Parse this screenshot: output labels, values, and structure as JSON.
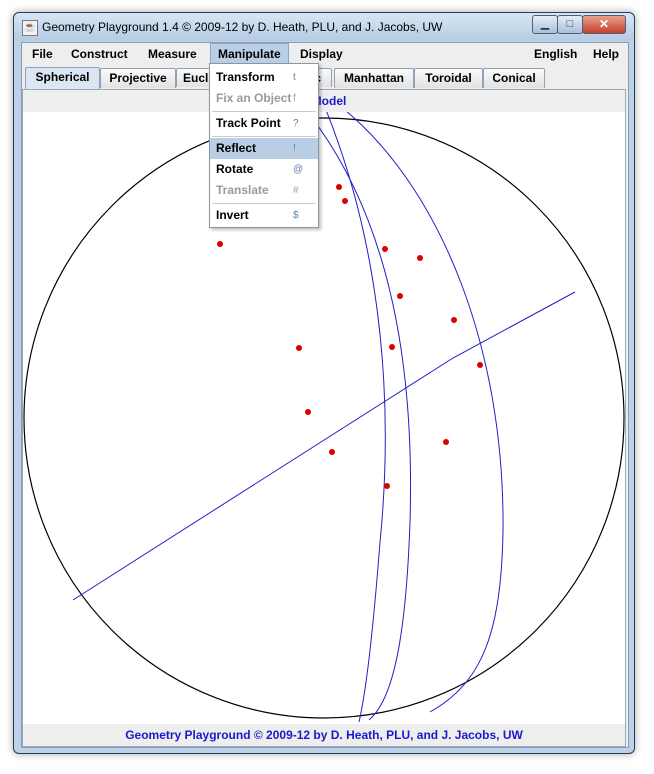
{
  "window": {
    "title": "Geometry Playground 1.4 © 2009-12 by D. Heath, PLU, and J. Jacobs, UW",
    "icon": "java-cup-icon",
    "buttons": {
      "minimize": "▁",
      "maximize": "□",
      "close": "✕"
    }
  },
  "menubar": {
    "items": [
      "File",
      "Construct",
      "Measure",
      "Manipulate",
      "Display"
    ],
    "right_items": [
      "English",
      "Help"
    ],
    "active": "Manipulate"
  },
  "tabs": [
    "Spherical",
    "Projective",
    "Eucl",
    "ic",
    "Manhattan",
    "Toroidal",
    "Conical"
  ],
  "selected_tab": "Spherical",
  "model_label": "e Model",
  "dropdown": {
    "items": [
      {
        "label": "Transform",
        "shortcut": "t",
        "enabled": true
      },
      {
        "label": "Fix an Object",
        "shortcut": "f",
        "enabled": false
      },
      {
        "label": "Track Point",
        "shortcut": "?",
        "enabled": true
      },
      {
        "label": "Reflect",
        "shortcut": "!",
        "enabled": true,
        "highlighted": true
      },
      {
        "label": "Rotate",
        "shortcut": "@",
        "enabled": true
      },
      {
        "label": "Translate",
        "shortcut": "#",
        "enabled": false
      },
      {
        "label": "Invert",
        "shortcut": "$",
        "enabled": true
      }
    ]
  },
  "footer": "Geometry Playground © 2009-12 by D. Heath, PLU, and J. Jacobs, UW",
  "colors": {
    "point": "#dd0000",
    "line": "#1f1fc8",
    "circle": "#000000",
    "label_text": "#1a1ac8",
    "menu_highlight": "#b8cfe5"
  }
}
